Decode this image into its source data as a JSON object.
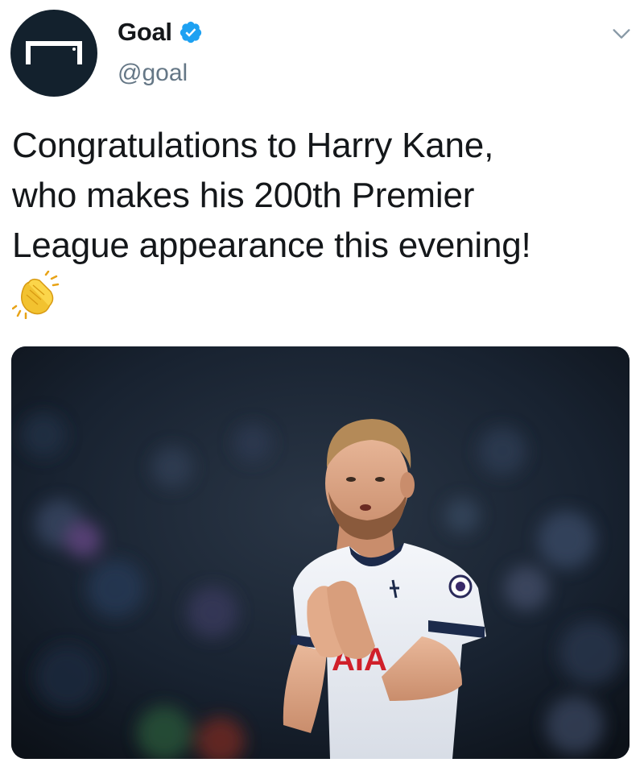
{
  "tweet": {
    "author": {
      "display_name": "Goal",
      "handle": "@goal",
      "verified": true,
      "avatar_icon": "goal-logo-icon"
    },
    "text_lines": [
      "Congratulations to Harry Kane,",
      "who makes his 200th Premier",
      "League appearance this evening!"
    ],
    "emoji": "👏",
    "menu_icon": "chevron-down-icon",
    "media": {
      "type": "photo",
      "jersey_text": "AIA"
    }
  },
  "colors": {
    "text": "#14171a",
    "secondary": "#657786",
    "verified": "#1da1f2",
    "avatar_bg": "#13212d"
  }
}
